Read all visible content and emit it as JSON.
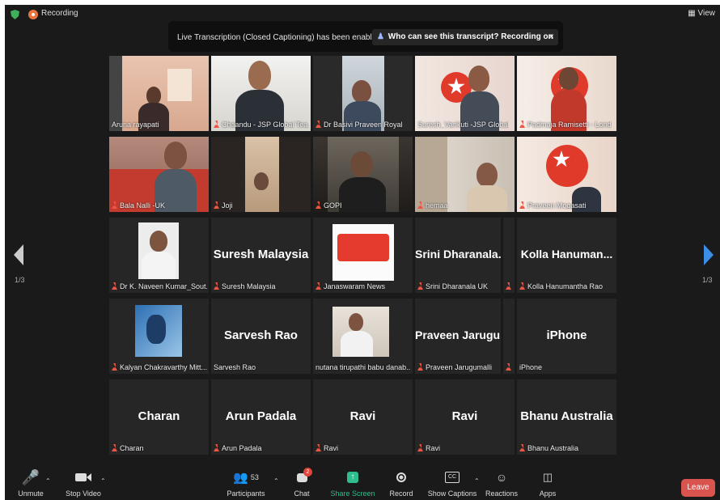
{
  "topbar": {
    "recording_label": "Recording",
    "view_label": "View"
  },
  "banner": {
    "text": "Live Transcription (Closed Captioning) has been enabled",
    "link": "Who can see this transcript? Recording on",
    "close": "×"
  },
  "pager": {
    "left": "1/3",
    "right": "1/3"
  },
  "tiles": [
    {
      "name": "Aruna rayapati",
      "big": ""
    },
    {
      "name": "Chaandu - JSP Global Tea...",
      "big": ""
    },
    {
      "name": "Dr Basivi Praveen Royal",
      "big": ""
    },
    {
      "name": "Suresh_Varikuti -JSP Global",
      "big": ""
    },
    {
      "name": "Padmaja Ramisetti - Lond",
      "big": ""
    },
    {
      "name": "Bala Nalli -UK",
      "big": ""
    },
    {
      "name": "Joji",
      "big": ""
    },
    {
      "name": "GOPI",
      "big": ""
    },
    {
      "name": "hemaa",
      "big": ""
    },
    {
      "name": "Praveen Mogasati",
      "big": ""
    },
    {
      "name": "Dr K. Naveen Kumar_Sout...",
      "big": ""
    },
    {
      "name": "Suresh Malaysia",
      "big": "Suresh Malaysia"
    },
    {
      "name": "Janaswaram News",
      "big": ""
    },
    {
      "name": "Srini Dharanala UK",
      "big": "Srini  Dharanala..."
    },
    {
      "name": "Kolla Hanumantha Rao",
      "big": "Kolla  Hanuman..."
    },
    {
      "name": "Kalyan Chakravarthy Mitt...",
      "big": ""
    },
    {
      "name": "Sarvesh Rao",
      "big": "Sarvesh Rao"
    },
    {
      "name": "nutana tirupathi babu danab...",
      "big": ""
    },
    {
      "name": "Praveen Jarugumalli",
      "big": "Praveen  Jarugu..."
    },
    {
      "name": "iPhone",
      "big": "iPhone"
    },
    {
      "name": "Charan",
      "big": "Charan"
    },
    {
      "name": "Arun Padala",
      "big": "Arun Padala"
    },
    {
      "name": "Ravi",
      "big": "Ravi"
    },
    {
      "name": "Ravi",
      "big": "Ravi"
    },
    {
      "name": "Bhanu Australia",
      "big": "Bhanu Australia"
    }
  ],
  "toolbar": {
    "unmute": "Unmute",
    "stop_video": "Stop Video",
    "participants": "Participants",
    "participants_count": "53",
    "chat": "Chat",
    "chat_badge": "2",
    "share": "Share Screen",
    "record": "Record",
    "captions": "Show Captions",
    "reactions": "Reactions",
    "apps": "Apps",
    "leave": "Leave"
  },
  "colors": {
    "share_accent": "#2dbd8f",
    "leave": "#d9534f",
    "nav_arrow": "#3b8de6"
  }
}
